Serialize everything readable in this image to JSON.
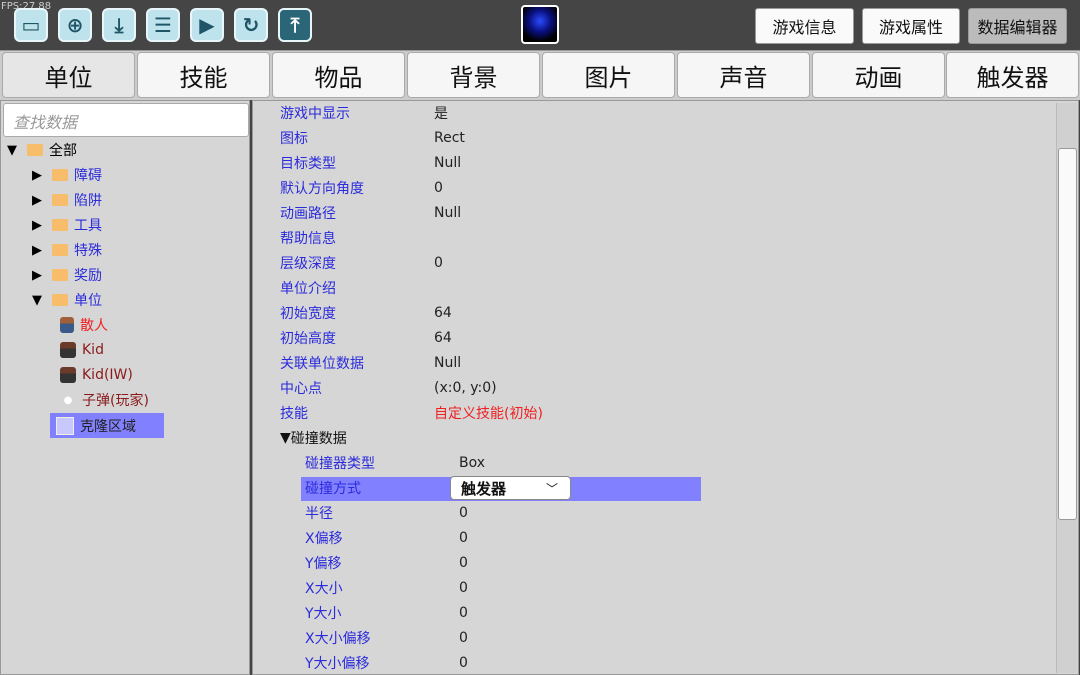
{
  "fps": "FPS:27.88",
  "toolbar": {
    "icons": [
      "folder-open-icon",
      "new-file-icon",
      "download-icon",
      "save-icon",
      "play-icon",
      "refresh-icon",
      "upload-icon"
    ],
    "buttons": [
      "游戏信息",
      "游戏属性",
      "数据编辑器"
    ]
  },
  "tabs": [
    "单位",
    "技能",
    "物品",
    "背景",
    "图片",
    "声音",
    "动画",
    "触发器"
  ],
  "search": {
    "placeholder": "查找数据"
  },
  "tree": {
    "root": "全部",
    "folders": [
      "障碍",
      "陷阱",
      "工具",
      "特殊",
      "奖励",
      "单位"
    ],
    "units": [
      "散人",
      "Kid",
      "Kid(IW)",
      "子弹(玩家)",
      "克隆区域"
    ]
  },
  "props": [
    {
      "label": "游戏中显示",
      "value": "是"
    },
    {
      "label": "图标",
      "value": "Rect"
    },
    {
      "label": "目标类型",
      "value": "Null"
    },
    {
      "label": "默认方向角度",
      "value": "0"
    },
    {
      "label": "动画路径",
      "value": "Null"
    },
    {
      "label": "帮助信息",
      "value": ""
    },
    {
      "label": "层级深度",
      "value": "0"
    },
    {
      "label": "单位介绍",
      "value": ""
    },
    {
      "label": "初始宽度",
      "value": "64"
    },
    {
      "label": "初始高度",
      "value": "64"
    },
    {
      "label": "关联单位数据",
      "value": "Null"
    },
    {
      "label": "中心点",
      "value": "(x:0, y:0)"
    },
    {
      "label": "技能",
      "value": "自定义技能(初始)"
    }
  ],
  "collision": {
    "title": "碰撞数据",
    "props": [
      {
        "label": "碰撞器类型",
        "value": "Box"
      },
      {
        "label": "碰撞方式",
        "value": "触发器"
      },
      {
        "label": "半径",
        "value": "0"
      },
      {
        "label": "X偏移",
        "value": "0"
      },
      {
        "label": "Y偏移",
        "value": "0"
      },
      {
        "label": "X大小",
        "value": "0"
      },
      {
        "label": "Y大小",
        "value": "0"
      },
      {
        "label": "X大小偏移",
        "value": "0"
      },
      {
        "label": "Y大小偏移",
        "value": "0"
      }
    ]
  },
  "colors": {
    "label": "#2b2bdc",
    "highlight": "#8181ff",
    "skill_value": "#f02020"
  }
}
